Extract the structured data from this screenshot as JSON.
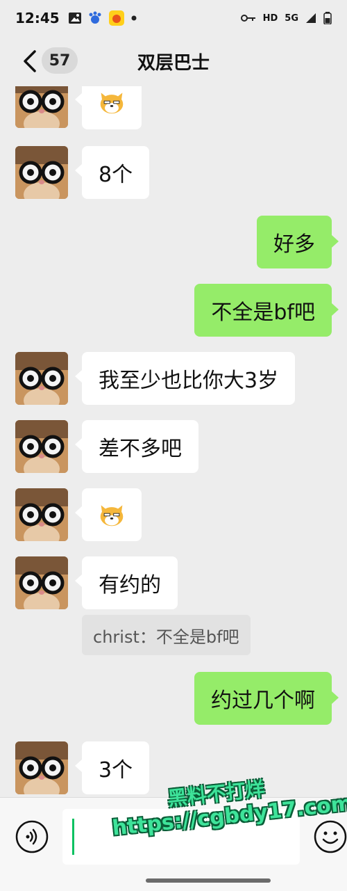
{
  "status_bar": {
    "time": "12:45",
    "right_text": [
      "HD",
      "5G"
    ],
    "icons": [
      "gallery-icon",
      "baidu-icon",
      "app-icon",
      "dot-icon",
      "key-icon",
      "signal-icon",
      "battery-icon"
    ]
  },
  "header": {
    "title": "双层巴士",
    "unread_count": "57"
  },
  "messages": [
    {
      "side": "left",
      "type": "emoji",
      "emoji": "dog-emoji"
    },
    {
      "side": "left",
      "type": "text",
      "text": "8个"
    },
    {
      "side": "right",
      "type": "text",
      "text": "好多"
    },
    {
      "side": "right",
      "type": "text",
      "text": "不全是bf吧"
    },
    {
      "side": "left",
      "type": "text",
      "text": "我至少也比你大3岁"
    },
    {
      "side": "left",
      "type": "text",
      "text": "差不多吧"
    },
    {
      "side": "left",
      "type": "emoji",
      "emoji": "dog-emoji"
    },
    {
      "side": "left",
      "type": "text",
      "text": "有约的",
      "quote": "christ：不全是bf吧"
    },
    {
      "side": "right",
      "type": "text",
      "text": "约过几个啊"
    },
    {
      "side": "left",
      "type": "text",
      "text": "3个"
    }
  ],
  "input_bar": {
    "value": "",
    "icons": [
      "voice-icon",
      "emoji-icon"
    ]
  },
  "watermark": {
    "line1": "黑料不打烊",
    "line2": "https://cgbdy17.com"
  },
  "colors": {
    "background": "#ededed",
    "bubble_left": "#ffffff",
    "bubble_right": "#95ec69",
    "caret": "#07c160"
  }
}
